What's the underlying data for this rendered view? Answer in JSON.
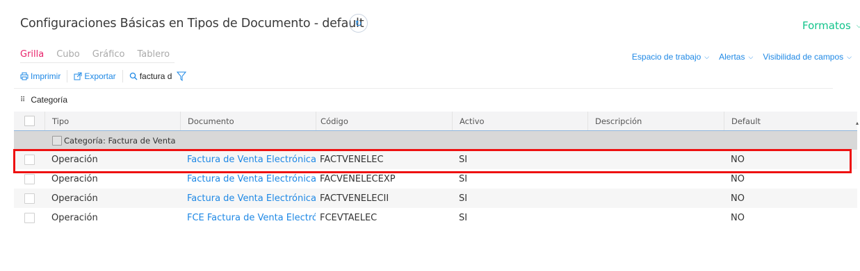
{
  "header": {
    "title": "Configuraciones Básicas en Tipos de Documento - default",
    "refresh_icon": "refresh-icon",
    "formatos_label": "Formatos"
  },
  "tabs": [
    {
      "label": "Grilla",
      "active": true
    },
    {
      "label": "Cubo",
      "active": false
    },
    {
      "label": "Gráfico",
      "active": false
    },
    {
      "label": "Tablero",
      "active": false
    }
  ],
  "right_menus": {
    "workspace": "Espacio de trabajo",
    "alerts": "Alertas",
    "field_visibility": "Visibilidad de campos"
  },
  "toolbar": {
    "print_label": "Imprimir",
    "export_label": "Exportar",
    "search_value": "factura d"
  },
  "grouping": {
    "label": "Categoría"
  },
  "grid": {
    "columns": [
      "Tipo",
      "Documento",
      "Código",
      "Activo",
      "Descripción",
      "Default"
    ],
    "group_label": "Categoría: Factura de Venta",
    "rows": [
      {
        "tipo": "Operación",
        "documento": "Factura de Venta Electrónica",
        "codigo": "FACTVENELEC",
        "activo": "SI",
        "descripcion": "",
        "default": "NO"
      },
      {
        "tipo": "Operación",
        "documento": "Factura de Venta Electrónica",
        "codigo": "FACVENELECEXP",
        "activo": "SI",
        "descripcion": "",
        "default": "NO"
      },
      {
        "tipo": "Operación",
        "documento": "Factura de Venta Electrónica",
        "codigo": "FACTVENELECII",
        "activo": "SI",
        "descripcion": "",
        "default": "NO"
      },
      {
        "tipo": "Operación",
        "documento": "FCE Factura de Venta Electrónica",
        "codigo": "FCEVTAELEC",
        "activo": "SI",
        "descripcion": "",
        "default": "NO"
      }
    ]
  },
  "colors": {
    "accent_blue": "#1e88e5",
    "active_tab": "#e8236b",
    "formatos_green": "#12c48b",
    "highlight_red": "#ee1111"
  }
}
